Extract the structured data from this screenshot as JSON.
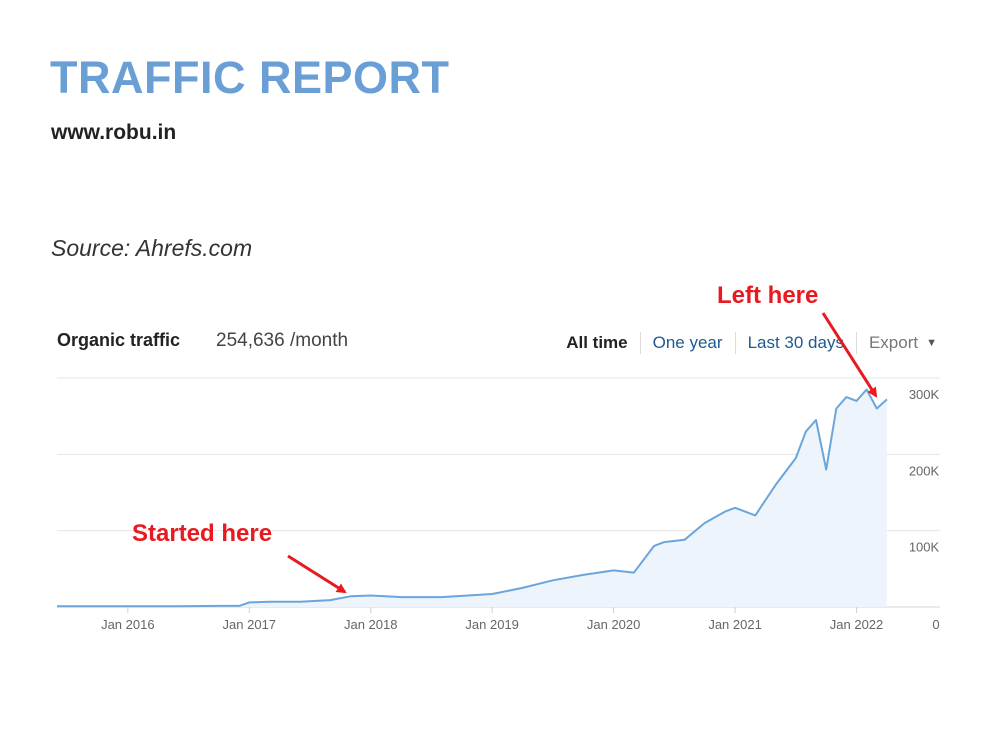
{
  "header": {
    "title": "TRAFFIC REPORT",
    "subtitle": "www.robu.in",
    "source": "Source: Ahrefs.com"
  },
  "widget": {
    "metric_label": "Organic traffic",
    "metric_value": "254,636 /month",
    "tabs": [
      "All time",
      "One year",
      "Last 30 days"
    ],
    "active_tab": "All time",
    "export_label": "Export"
  },
  "annotations": {
    "left_here": "Left here",
    "started_here": "Started here"
  },
  "colors": {
    "title": "#6a9fd6",
    "line": "#6aa6dc",
    "area": "#eef4fb",
    "annotation": "#e8191f",
    "grid": "#e6e6e6"
  },
  "chart_data": {
    "type": "area",
    "title": "",
    "xlabel": "",
    "ylabel": "",
    "x_ticks": [
      "Jan 2016",
      "Jan 2017",
      "Jan 2018",
      "Jan 2019",
      "Jan 2020",
      "Jan 2021",
      "Jan 2022"
    ],
    "y_ticks": [
      "0",
      "100K",
      "200K",
      "300K"
    ],
    "ylim": [
      0,
      300000
    ],
    "xlim": [
      "2015-06",
      "2022-05"
    ],
    "grid": true,
    "y_axis_position": "right",
    "series": [
      {
        "x": [
          "2015-06",
          "2016-01",
          "2016-06",
          "2016-10",
          "2016-12",
          "2017-01",
          "2017-03",
          "2017-06",
          "2017-09",
          "2017-11",
          "2018-01",
          "2018-04",
          "2018-08",
          "2019-01",
          "2019-04",
          "2019-07",
          "2019-10",
          "2020-01",
          "2020-03",
          "2020-05",
          "2020-06",
          "2020-08",
          "2020-10",
          "2020-12",
          "2021-01",
          "2021-03",
          "2021-05",
          "2021-07",
          "2021-08",
          "2021-09",
          "2021-10",
          "2021-11",
          "2021-12",
          "2022-01",
          "2022-02",
          "2022-03",
          "2022-04"
        ],
        "y": [
          1000,
          1000,
          1000,
          1500,
          1500,
          6000,
          7000,
          7000,
          9000,
          14000,
          15000,
          13000,
          13000,
          17000,
          25000,
          35000,
          42000,
          48000,
          45000,
          80000,
          85000,
          88000,
          110000,
          125000,
          130000,
          120000,
          160000,
          195000,
          230000,
          245000,
          180000,
          260000,
          275000,
          270000,
          285000,
          260000,
          272000
        ]
      }
    ]
  }
}
